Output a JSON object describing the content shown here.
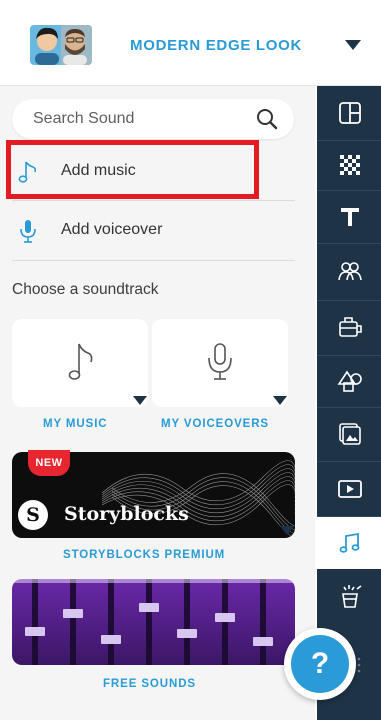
{
  "header": {
    "project_title": "MODERN EDGE LOOK",
    "avatar_icon": "two-person-avatar-icon",
    "dropdown_icon": "chevron-down-icon"
  },
  "panel": {
    "search": {
      "placeholder": "Search Sound",
      "icon": "search-icon"
    },
    "actions": [
      {
        "label": "Add music",
        "icon": "music-note-icon",
        "highlighted": true
      },
      {
        "label": "Add voiceover",
        "icon": "microphone-icon"
      }
    ],
    "section_label": "Choose a soundtrack",
    "tiles": [
      {
        "caption": "MY MUSIC",
        "icon": "music-note-icon"
      },
      {
        "caption": "MY VOICEOVERS",
        "icon": "microphone-icon"
      }
    ],
    "storyblocks": {
      "badge": "NEW",
      "brand": "Storyblocks",
      "logo_letter": "S",
      "caption": "STORYBLOCKS PREMIUM"
    },
    "free_sounds": {
      "caption": "FREE SOUNDS"
    }
  },
  "rail": {
    "items": [
      {
        "icon": "layout-icon"
      },
      {
        "icon": "texture-icon"
      },
      {
        "icon": "text-icon"
      },
      {
        "icon": "people-icon"
      },
      {
        "icon": "briefcase-icon"
      },
      {
        "icon": "shapes-icon"
      },
      {
        "icon": "images-icon"
      },
      {
        "icon": "video-icon"
      },
      {
        "icon": "music-icon",
        "active": true
      },
      {
        "icon": "effects-icon"
      }
    ]
  },
  "help": {
    "label": "?"
  },
  "colors": {
    "accent": "#2a9bd6",
    "rail": "#1f3347",
    "highlight": "#e41b23",
    "badge": "#e8262f"
  }
}
